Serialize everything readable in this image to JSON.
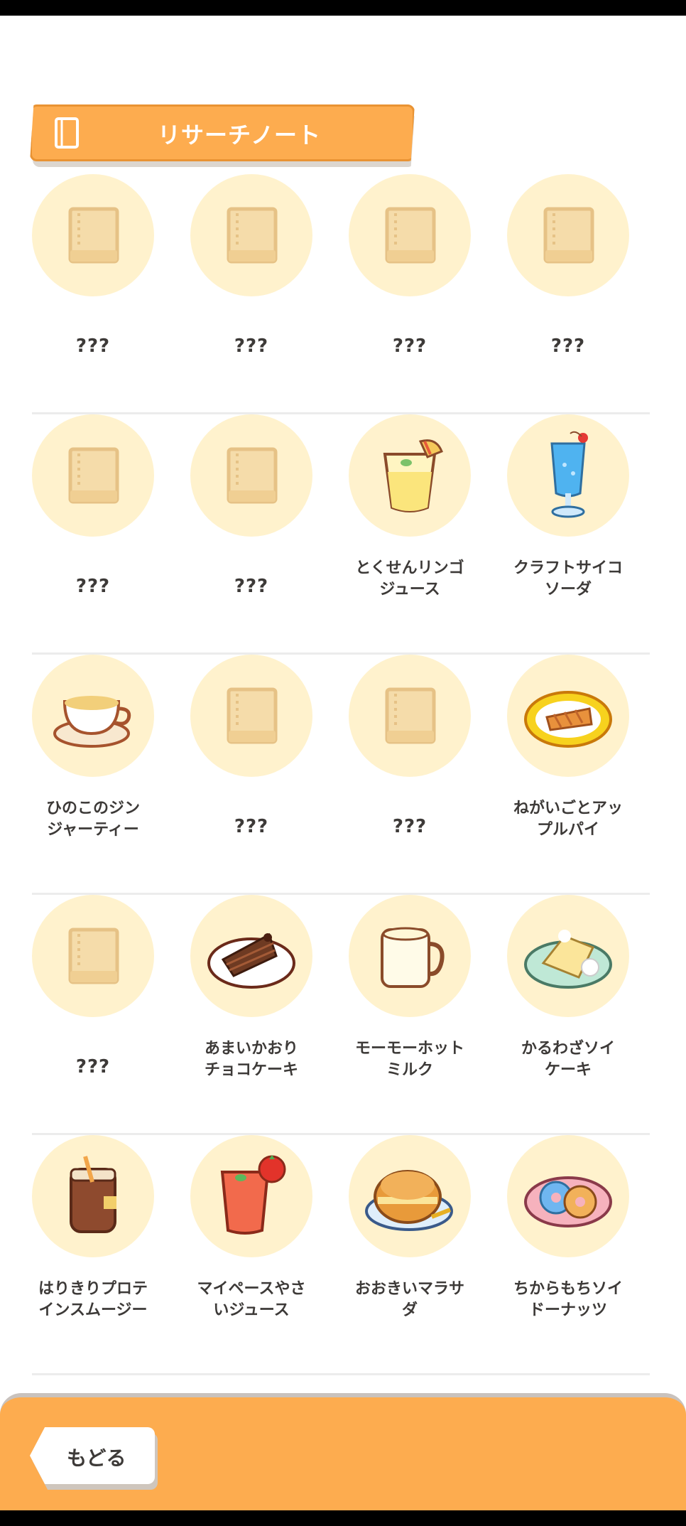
{
  "header": {
    "title": "リサーチノート",
    "icon": "book-icon"
  },
  "rows": [
    [
      {
        "label": "???",
        "icon": "book-icon",
        "known": false
      },
      {
        "label": "???",
        "icon": "book-icon",
        "known": false
      },
      {
        "label": "???",
        "icon": "book-icon",
        "known": false
      },
      {
        "label": "???",
        "icon": "book-icon",
        "known": false
      }
    ],
    [
      {
        "label": "???",
        "icon": "book-icon",
        "known": false
      },
      {
        "label": "???",
        "icon": "book-icon",
        "known": false
      },
      {
        "label": "とくせんリンゴ\nジュース",
        "icon": "apple-juice-icon",
        "known": true
      },
      {
        "label": "クラフトサイコ\nソーダ",
        "icon": "soda-icon",
        "known": true
      }
    ],
    [
      {
        "label": "ひのこのジン\nジャーティー",
        "icon": "ginger-tea-icon",
        "known": true
      },
      {
        "label": "???",
        "icon": "book-icon",
        "known": false
      },
      {
        "label": "???",
        "icon": "book-icon",
        "known": false
      },
      {
        "label": "ねがいごとアッ\nプルパイ",
        "icon": "apple-pie-icon",
        "known": true
      }
    ],
    [
      {
        "label": "???",
        "icon": "book-icon",
        "known": false
      },
      {
        "label": "あまいかおり\nチョコケーキ",
        "icon": "chocolate-cake-icon",
        "known": true
      },
      {
        "label": "モーモーホット\nミルク",
        "icon": "hot-milk-icon",
        "known": true
      },
      {
        "label": "かるわざソイ\nケーキ",
        "icon": "soy-cake-icon",
        "known": true
      }
    ],
    [
      {
        "label": "はりきりプロテ\nインスムージー",
        "icon": "protein-smoothie-icon",
        "known": true
      },
      {
        "label": "マイペースやさ\nいジュース",
        "icon": "vegetable-juice-icon",
        "known": true
      },
      {
        "label": "おおきいマラサ\nダ",
        "icon": "malasada-icon",
        "known": true
      },
      {
        "label": "ちからもちソイ\nドーナッツ",
        "icon": "soy-donut-icon",
        "known": true
      }
    ]
  ],
  "footer": {
    "back_label": "もどる"
  },
  "colors": {
    "accent": "#fdac4f",
    "circle": "#fff2cd",
    "text": "#3d3a38"
  }
}
